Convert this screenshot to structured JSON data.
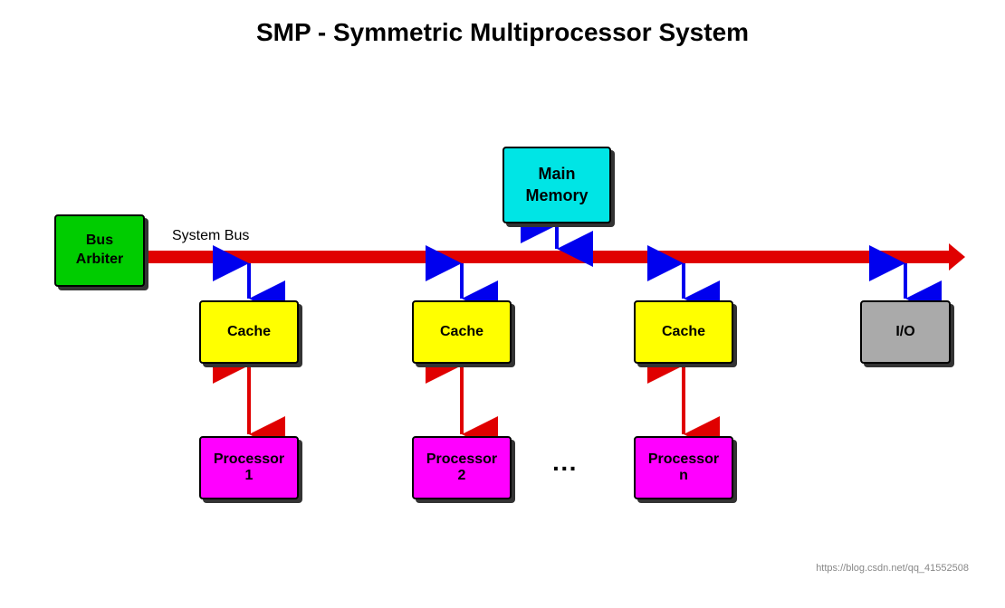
{
  "title": "SMP - Symmetric Multiprocessor System",
  "components": {
    "main_memory": "Main\nMemory",
    "bus_arbiter": "Bus\nArbiter",
    "cache_1": "Cache",
    "cache_2": "Cache",
    "cache_3": "Cache",
    "io": "I/O",
    "processor_1": "Processor\n1",
    "processor_2": "Processor\n2",
    "processor_n": "Processor\nn",
    "system_bus_label": "System Bus",
    "dots": "···"
  },
  "watermark": "https://blog.csdn.net/qq_41552508"
}
